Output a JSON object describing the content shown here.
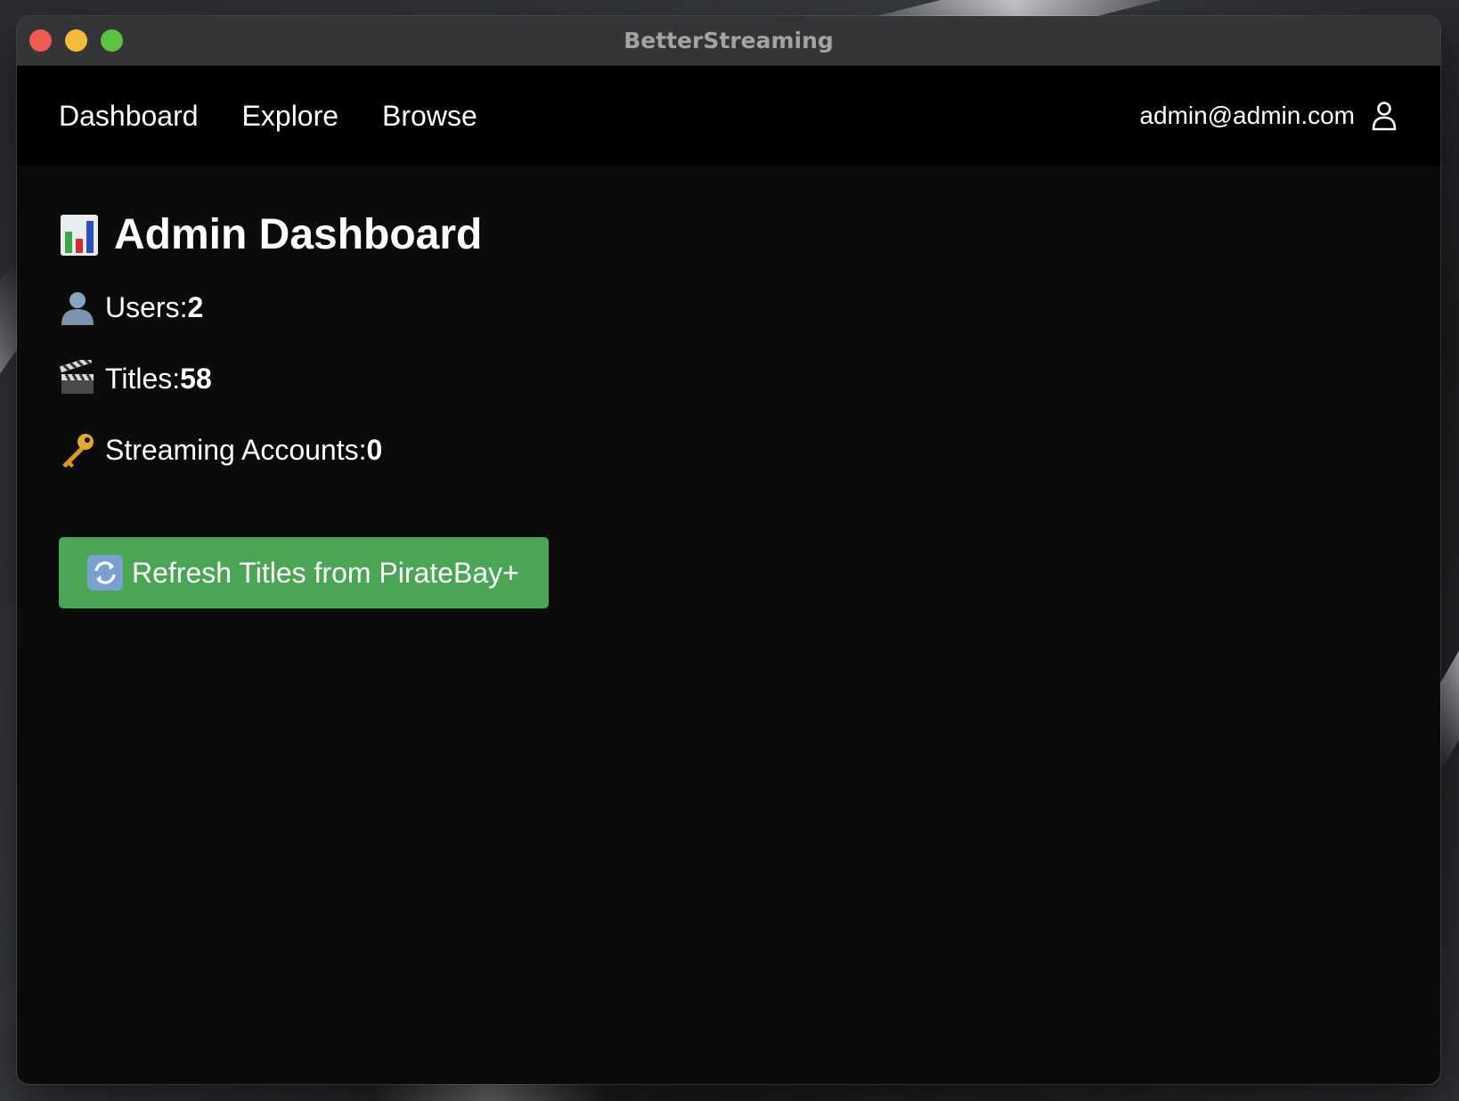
{
  "window": {
    "title": "BetterStreaming"
  },
  "nav": {
    "links": [
      {
        "label": "Dashboard"
      },
      {
        "label": "Explore"
      },
      {
        "label": "Browse"
      }
    ],
    "user_email": "admin@admin.com",
    "user_icon": "user-icon"
  },
  "dashboard": {
    "title_icon": "bar-chart-icon",
    "title": "Admin Dashboard",
    "stats": [
      {
        "icon": "bust-in-silhouette-icon",
        "label": "Users: ",
        "value": "2"
      },
      {
        "icon": "clapper-board-icon",
        "label": "Titles: ",
        "value": "58"
      },
      {
        "icon": "key-icon",
        "label": "Streaming Accounts: ",
        "value": "0"
      }
    ],
    "refresh_button": {
      "icon": "refresh-arrows-icon",
      "label": "Refresh Titles from PirateBay+"
    }
  },
  "colors": {
    "window_bg": "#0b0b0c",
    "navbar_bg": "#000000",
    "titlebar_bg": "#353537",
    "button_green": "#4aa655",
    "traffic_close": "#ee5b53",
    "traffic_minimize": "#f5bc3b",
    "traffic_zoom": "#5ac342"
  }
}
